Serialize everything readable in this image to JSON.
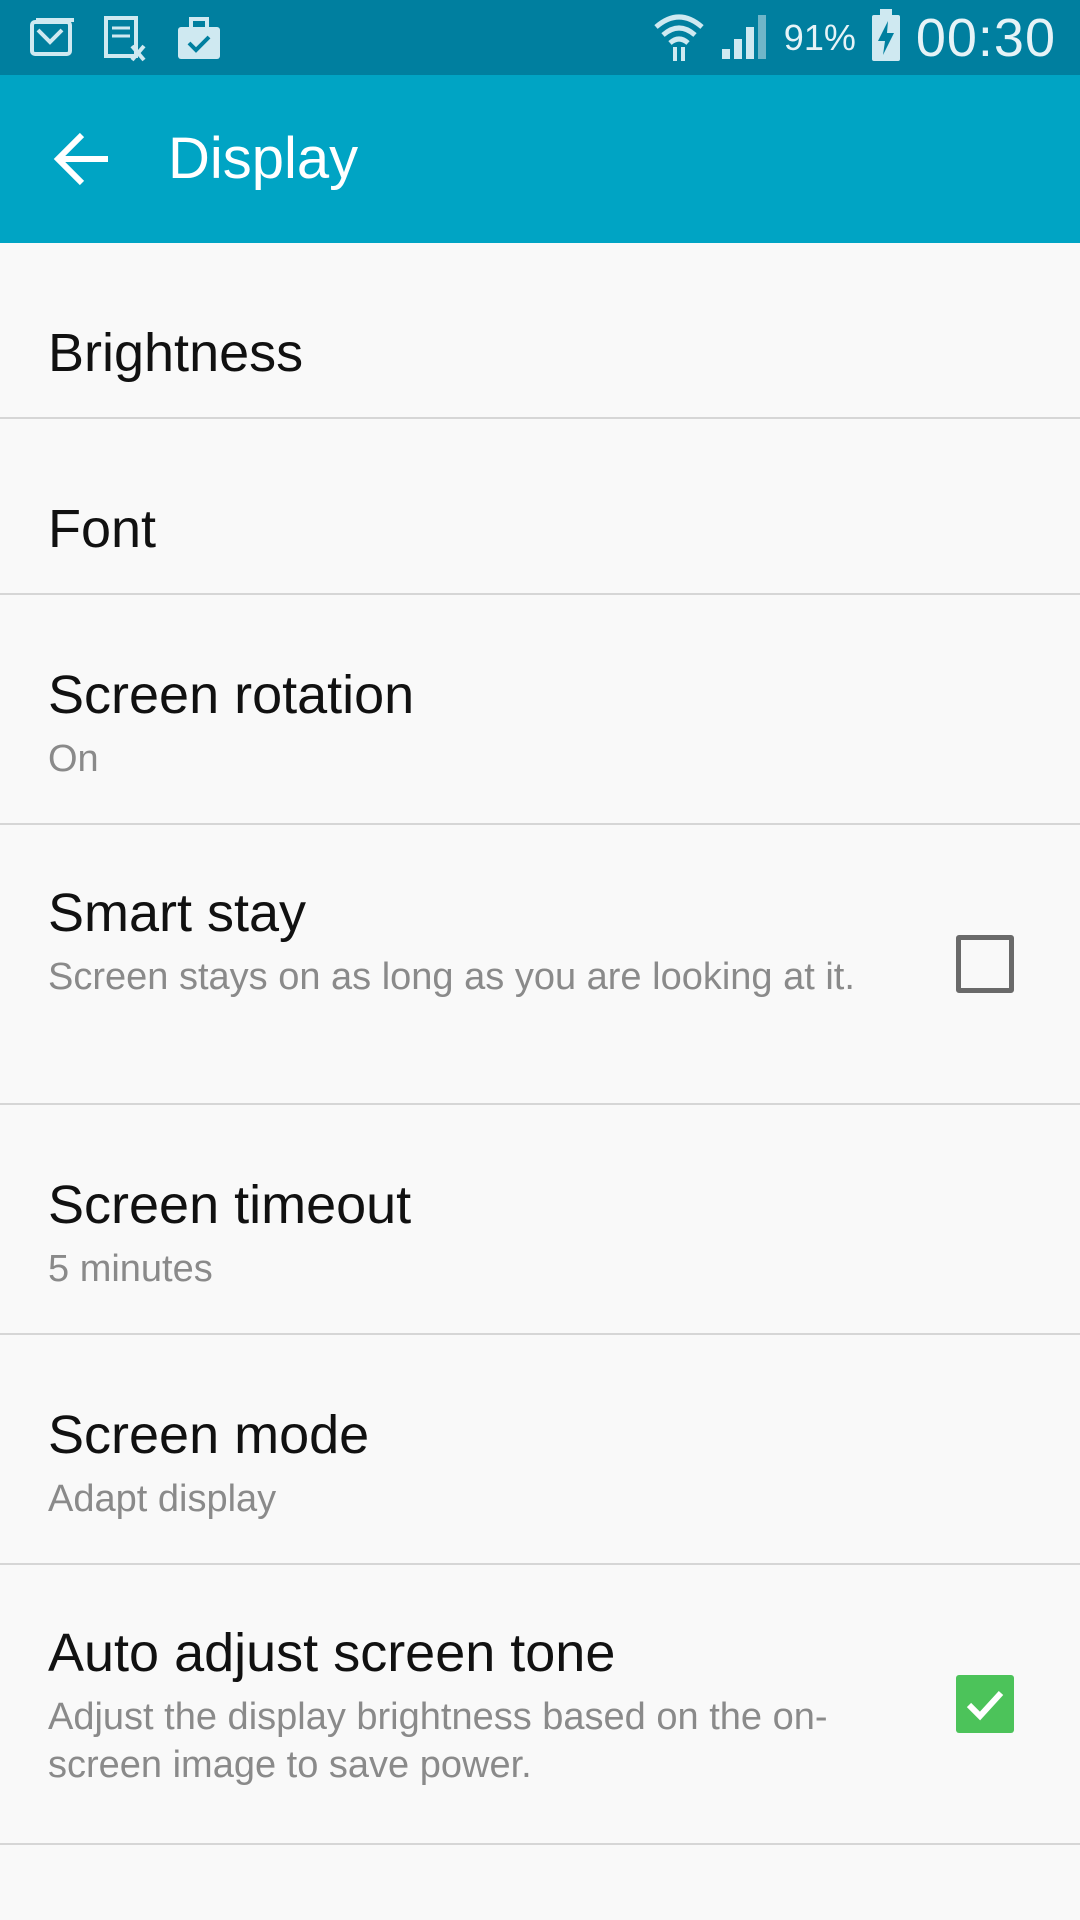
{
  "status_bar": {
    "battery_percent": "91%",
    "time": "00:30",
    "left_icons": [
      "gmail-icon",
      "document-icon",
      "briefcase-check-icon"
    ],
    "right_icons": [
      "wifi-icon",
      "signal-icon",
      "battery-charging-icon"
    ]
  },
  "app_bar": {
    "title": "Display",
    "back_icon": "arrow-back-icon"
  },
  "settings": [
    {
      "label": "Brightness"
    },
    {
      "label": "Font"
    },
    {
      "label": "Screen rotation",
      "summary": "On"
    },
    {
      "label": "Smart stay",
      "summary": "Screen stays on as long as you are looking at it.",
      "checked": false
    },
    {
      "label": "Screen timeout",
      "summary": "5 minutes"
    },
    {
      "label": "Screen mode",
      "summary": "Adapt display"
    },
    {
      "label": "Auto adjust screen tone",
      "summary": "Adjust the display brightness based on the on-screen image to save power.",
      "checked": true
    }
  ],
  "colors": {
    "status_bar": "#007f9f",
    "app_bar": "#00a4c4",
    "checkbox_checked": "#4cc35a"
  }
}
